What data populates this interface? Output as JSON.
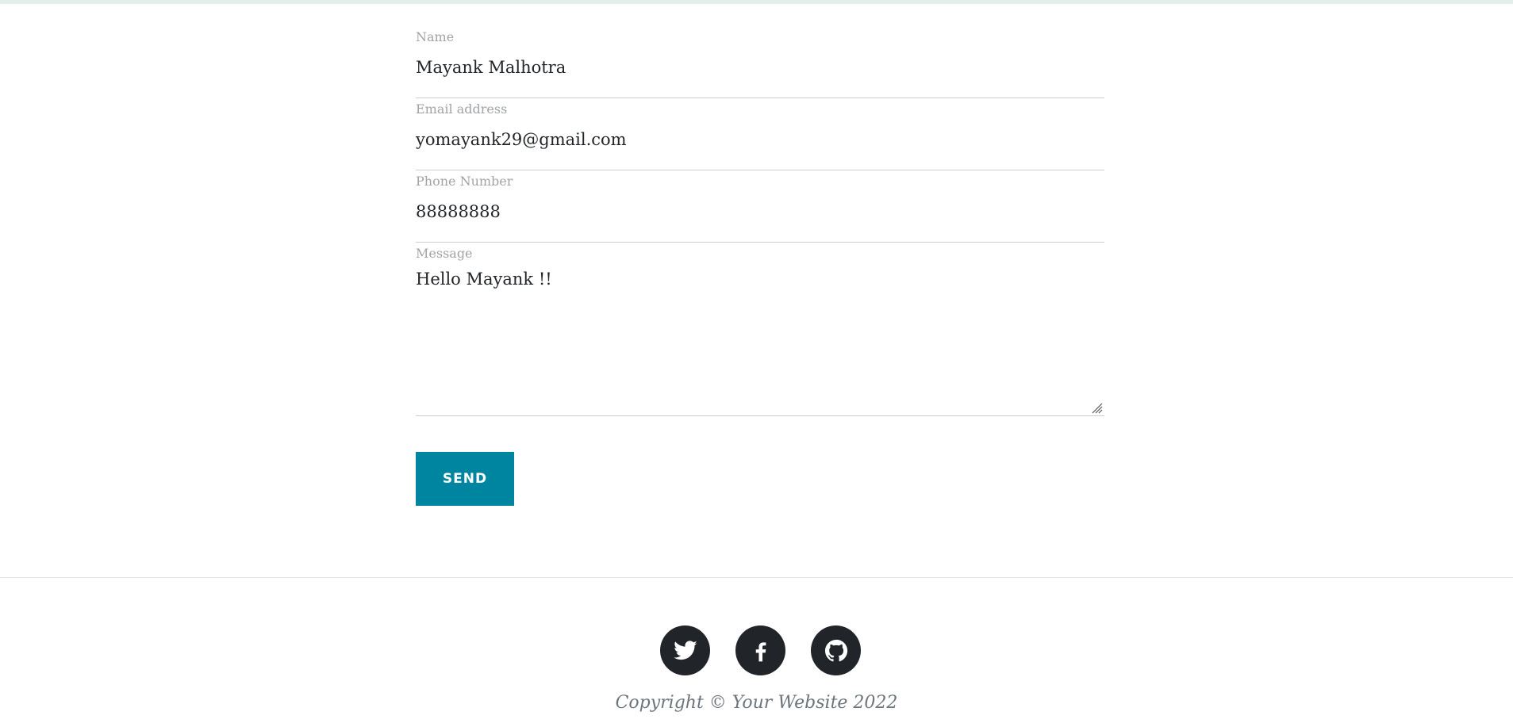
{
  "form": {
    "name": {
      "label": "Name",
      "value": "Mayank Malhotra"
    },
    "email": {
      "label": "Email address",
      "value": "yomayank29@gmail.com"
    },
    "phone": {
      "label": "Phone Number",
      "value": "88888888"
    },
    "message": {
      "label": "Message",
      "value": "Hello Mayank !!"
    },
    "send_label": "SEND"
  },
  "footer": {
    "social": [
      {
        "icon": "twitter-icon"
      },
      {
        "icon": "facebook-icon"
      },
      {
        "icon": "github-icon"
      }
    ],
    "copyright": "Copyright © Your Website 2022"
  },
  "colors": {
    "accent": "#0085a1",
    "social_bg": "#212529",
    "label": "#a0a3a6",
    "muted": "#6c757d"
  }
}
